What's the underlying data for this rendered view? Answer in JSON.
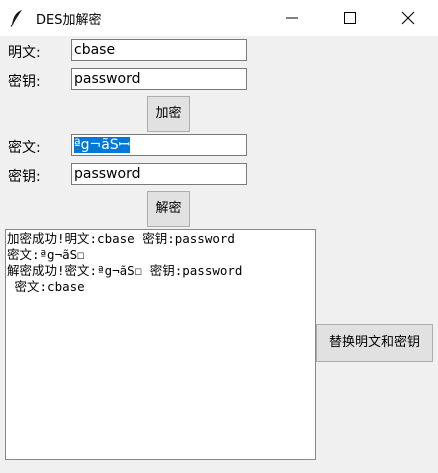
{
  "window": {
    "title": "DES加解密"
  },
  "encrypt": {
    "plaintext_label": "明文:",
    "plaintext_value": "cbase",
    "key_label": "密钥:",
    "key_value": "password",
    "button_label": "加密"
  },
  "decrypt": {
    "ciphertext_label": "密文:",
    "ciphertext_value": "ªg¬ãSꟷ",
    "key_label": "密钥:",
    "key_value": "password",
    "button_label": "解密"
  },
  "output": {
    "lines": [
      "加密成功!明文:cbase 密钥:password",
      "密文:ªg¬ãS☐",
      "解密成功!密文:ªg¬ãS☐ 密钥:password",
      " 密文:cbase"
    ]
  },
  "swap_button_label": "替换明文和密钥"
}
